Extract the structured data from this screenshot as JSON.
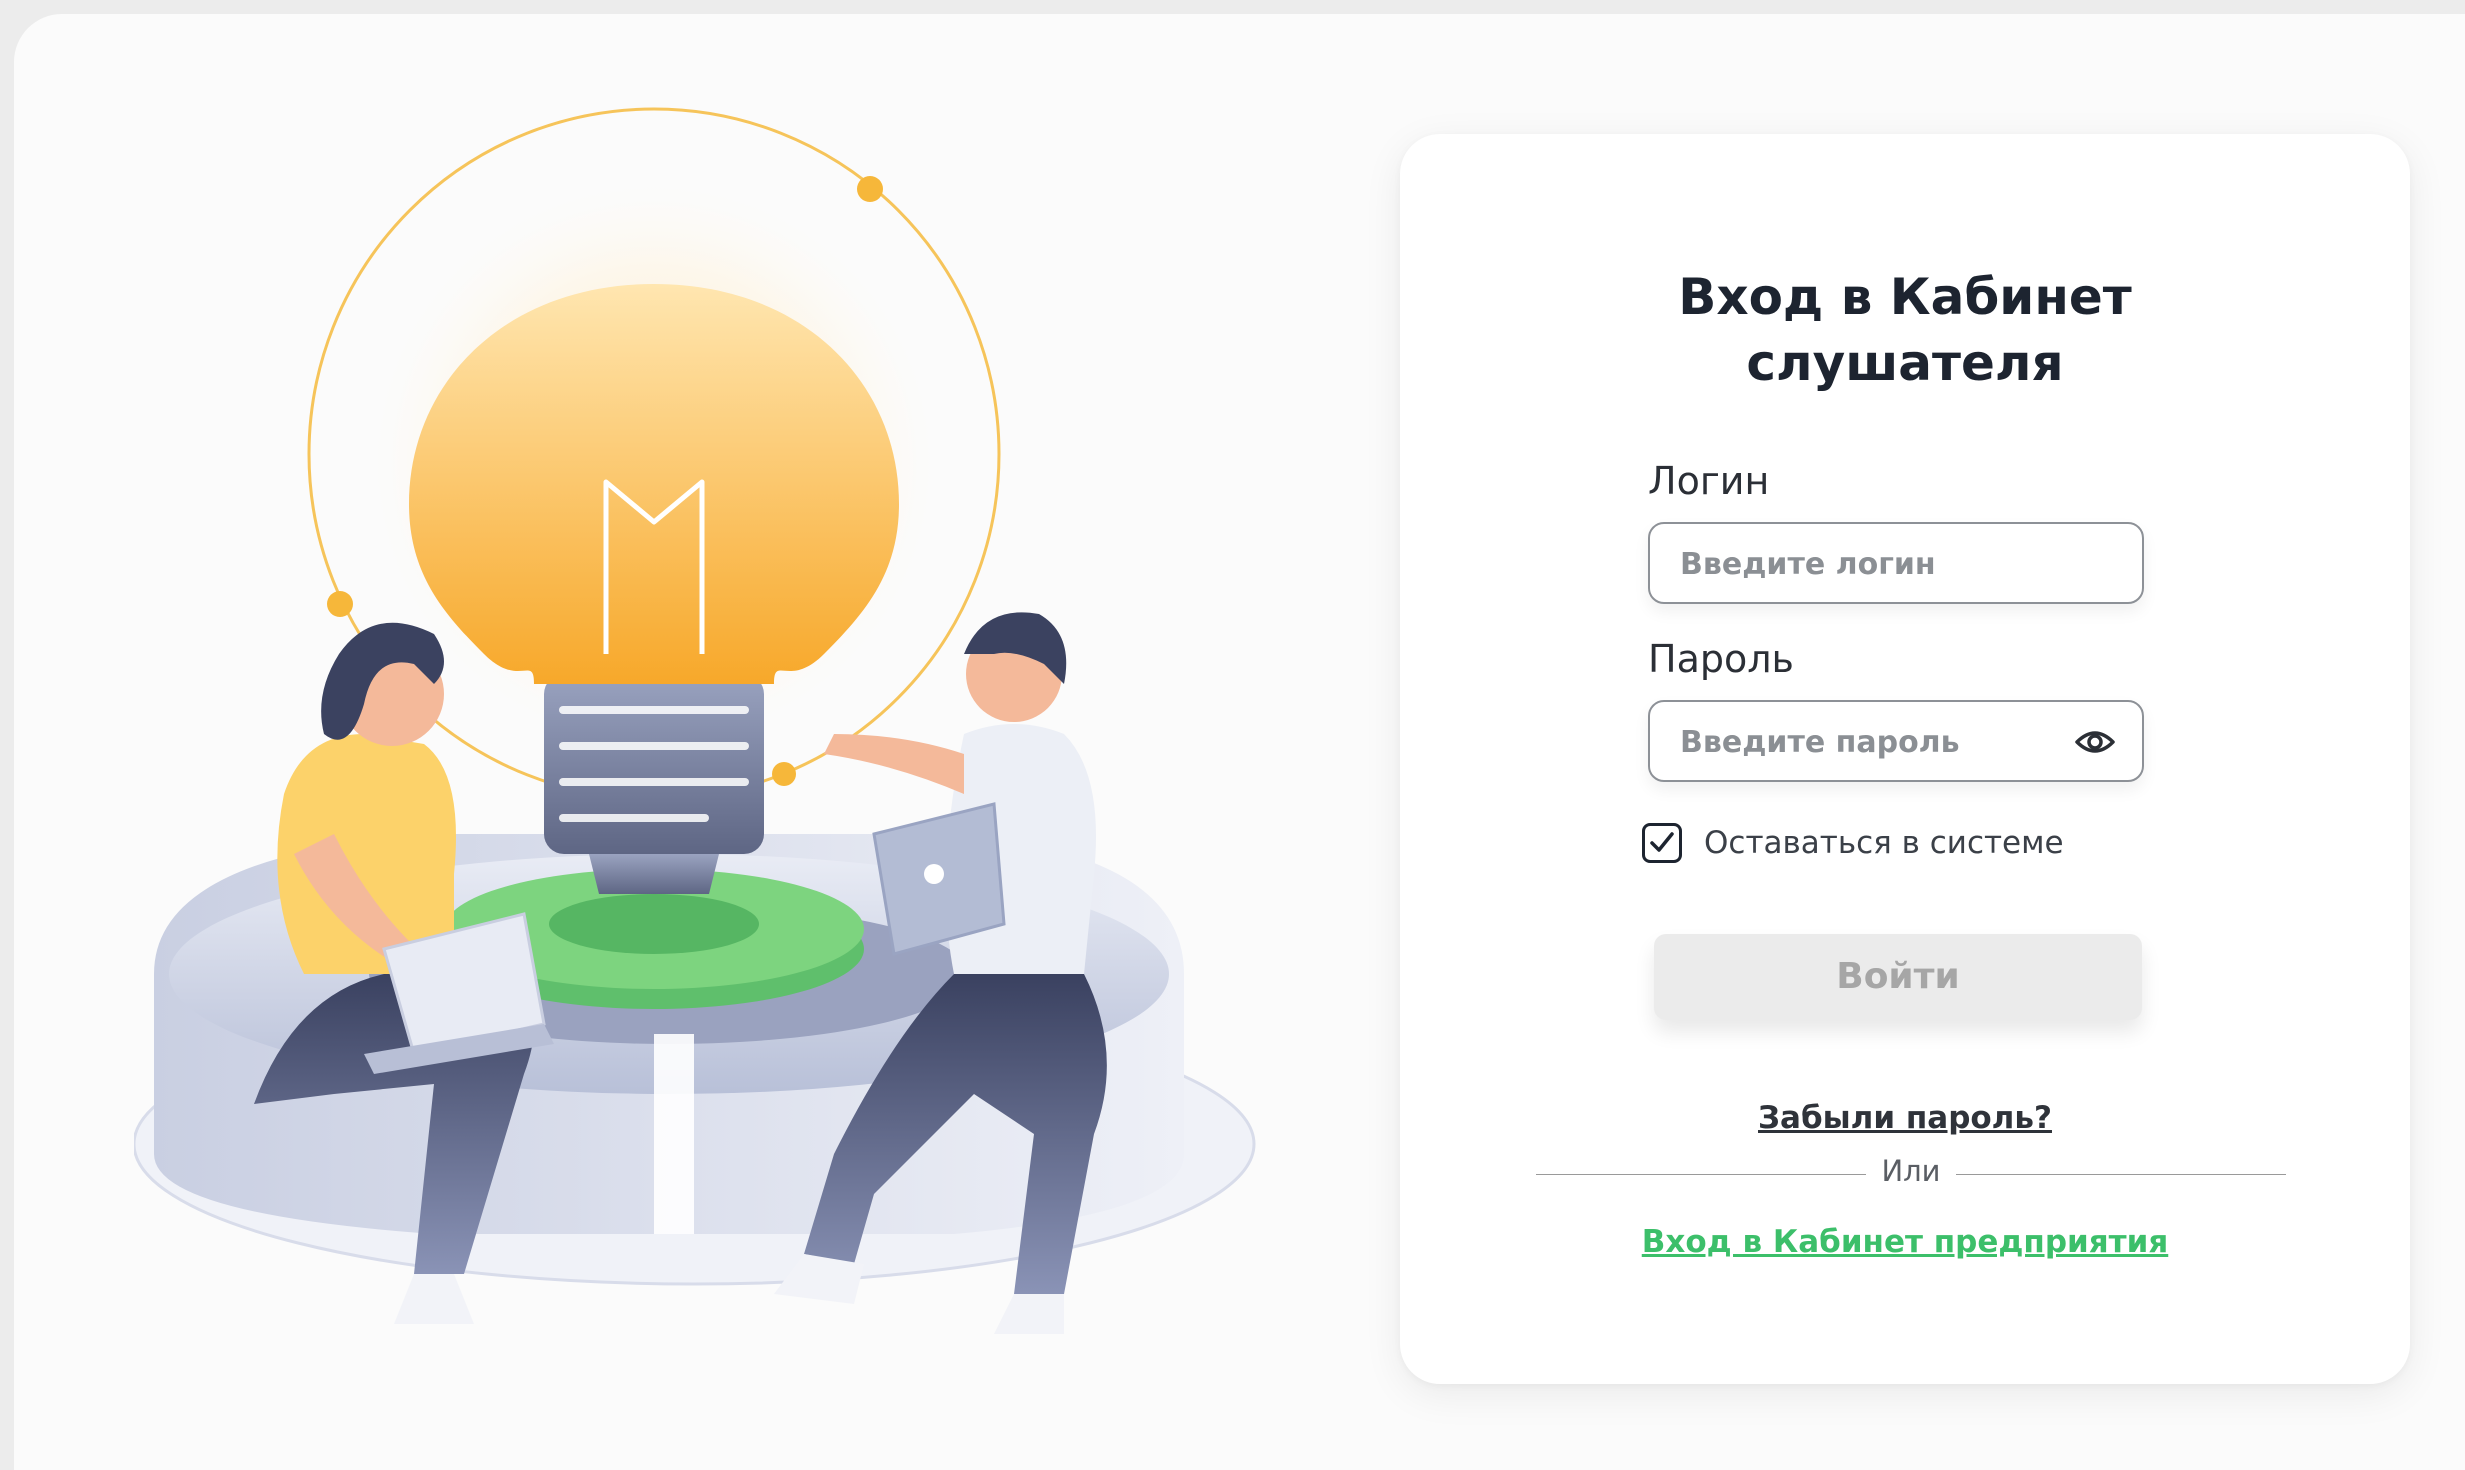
{
  "login_card": {
    "title": "Вход в Кабинет\nслушателя",
    "login": {
      "label": "Логин",
      "placeholder": "Введите логин",
      "value": ""
    },
    "password": {
      "label": "Пароль",
      "placeholder": "Введите пароль",
      "value": "",
      "toggle_icon": "eye-icon"
    },
    "remember": {
      "label": "Оставаться в системе",
      "checked": true
    },
    "submit_label": "Войти",
    "forgot_label": "Забыли пароль?",
    "divider_label": "Или",
    "enterprise_label": "Вход в Кабинет предприятия"
  },
  "colors": {
    "title": "#1d2430",
    "accent_green": "#3cbf6a",
    "button_bg": "#ebebeb",
    "button_text": "#a6a6a6",
    "bulb_glow": "#f9b234"
  },
  "illustration": {
    "icon": "lightbulb-teamwork-illustration"
  }
}
